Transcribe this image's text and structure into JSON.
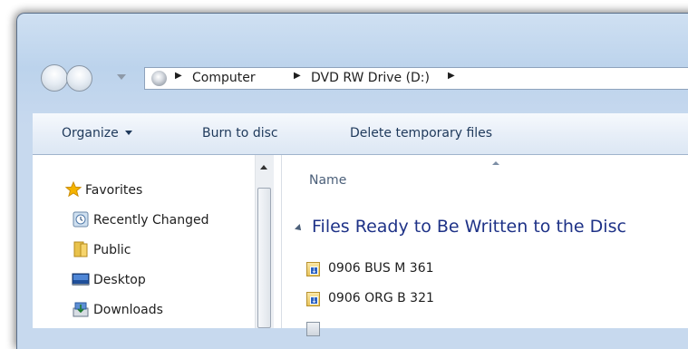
{
  "address": {
    "icon": "computer-disc-icon",
    "crumbs": [
      "Computer",
      "DVD RW Drive (D:)"
    ]
  },
  "toolbar": {
    "organize_label": "Organize",
    "burn_label": "Burn to disc",
    "delete_temp_label": "Delete temporary files"
  },
  "sidebar": {
    "favorites_label": "Favorites",
    "items": [
      {
        "label": "Recently Changed",
        "icon": "recent-places-icon"
      },
      {
        "label": "Public",
        "icon": "folder-icon"
      },
      {
        "label": "Desktop",
        "icon": "desktop-icon"
      },
      {
        "label": "Downloads",
        "icon": "downloads-icon"
      }
    ]
  },
  "content": {
    "column_name": "Name",
    "group_title": "Files Ready to Be Written to the Disc",
    "files": [
      {
        "name": "0906 BUS M 361"
      },
      {
        "name": "0906 ORG B 321"
      }
    ]
  },
  "colors": {
    "command_text": "#1e395b",
    "group_header": "#1e3287",
    "column_header": "#4c607a"
  }
}
